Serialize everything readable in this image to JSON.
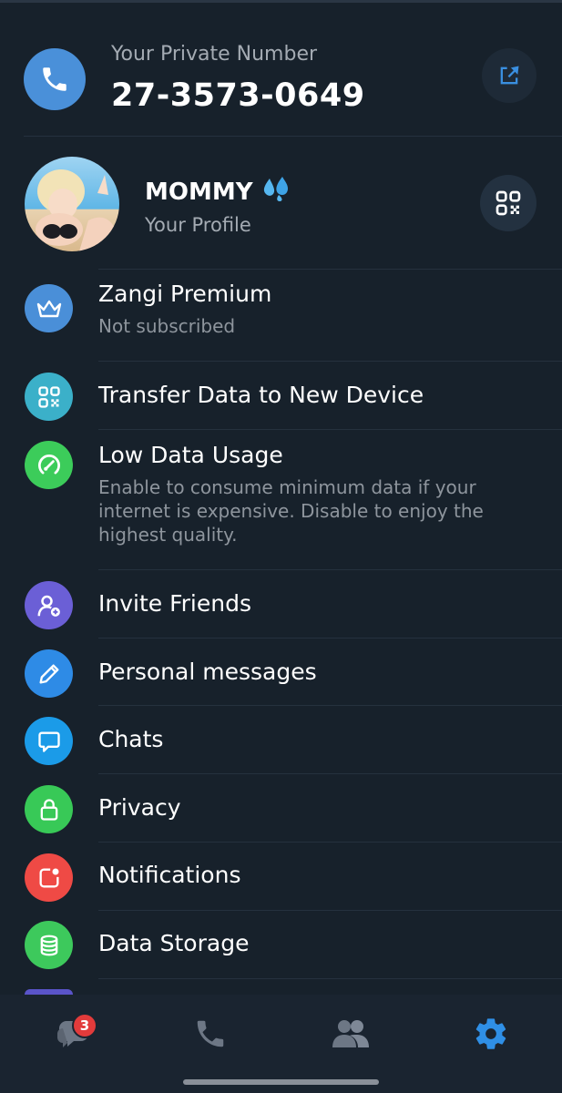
{
  "private_number": {
    "label": "Your Private Number",
    "value": "27-3573-0649"
  },
  "profile": {
    "name": "MOMMY",
    "emoji": "💦",
    "subtitle": "Your Profile"
  },
  "menu": {
    "premium": {
      "title": "Zangi Premium",
      "subtitle": "Not subscribed",
      "icon": "crown-icon",
      "color": "#4a8fd8"
    },
    "transfer": {
      "title": "Transfer Data to New Device",
      "icon": "qr-code-icon",
      "color": "#3bb0c9"
    },
    "low_data": {
      "title": "Low Data Usage",
      "subtitle": "Enable to consume minimum data if your internet is expensive. Disable to enjoy the highest quality.",
      "icon": "gauge-icon",
      "color": "#3ccc5a"
    },
    "invite": {
      "title": "Invite Friends",
      "icon": "add-person-icon",
      "color": "#6b5fd6"
    },
    "personal": {
      "title": "Personal messages",
      "icon": "pencil-icon",
      "color": "#2e8be6"
    },
    "chats": {
      "title": "Chats",
      "icon": "chat-bubble-icon",
      "color": "#1b9be8"
    },
    "privacy": {
      "title": "Privacy",
      "icon": "lock-icon",
      "color": "#38c957"
    },
    "notifications": {
      "title": "Notifications",
      "icon": "notification-icon",
      "color": "#ef4a45"
    },
    "storage": {
      "title": "Data Storage",
      "icon": "database-icon",
      "color": "#3dc95c"
    }
  },
  "bottom_nav": {
    "chats_badge": "3",
    "items": [
      "chats-icon",
      "calls-icon",
      "contacts-icon",
      "settings-icon"
    ],
    "active_color": "#2f8fe6",
    "inactive_color": "#6d7785"
  }
}
